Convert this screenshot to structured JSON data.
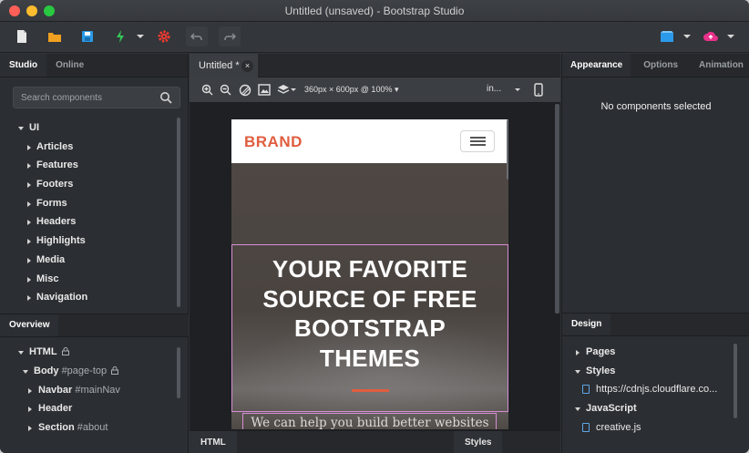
{
  "window": {
    "title": "Untitled (unsaved) - Bootstrap Studio"
  },
  "toolbar": {
    "icons": [
      "new-file-icon",
      "open-folder-icon",
      "save-icon",
      "preview-lightning-icon",
      "settings-icon",
      "undo-icon",
      "redo-icon",
      "export-icon",
      "publish-cloud-icon"
    ]
  },
  "left": {
    "tabs": [
      {
        "label": "Studio"
      },
      {
        "label": "Online"
      }
    ],
    "search_placeholder": "Search components",
    "root": "UI",
    "items": [
      {
        "label": "Articles"
      },
      {
        "label": "Features"
      },
      {
        "label": "Footers"
      },
      {
        "label": "Forms"
      },
      {
        "label": "Headers"
      },
      {
        "label": "Highlights"
      },
      {
        "label": "Media"
      },
      {
        "label": "Misc"
      },
      {
        "label": "Navigation"
      }
    ],
    "overview_tab": "Overview",
    "overview": {
      "html": "HTML",
      "body": "Body",
      "body_hint": "#page-top",
      "navbar": "Navbar",
      "navbar_hint": "#mainNav",
      "header": "Header",
      "section": "Section",
      "section_hint": "#about"
    }
  },
  "center": {
    "doc_tab": "Untitled *",
    "close_glyph": "×",
    "viewport": "360px × 600px @ 100% ▾",
    "insert_label": "in...",
    "page": {
      "brand": "BRAND",
      "heading_lines": [
        "YOUR FAVORITE",
        "SOURCE OF FREE",
        "BOOTSTRAP",
        "THEMES"
      ],
      "subtext": "We can help you build better websites"
    },
    "bottom_tabs": {
      "html": "HTML",
      "styles": "Styles"
    }
  },
  "right": {
    "tabs": [
      {
        "label": "Appearance"
      },
      {
        "label": "Options"
      },
      {
        "label": "Animation"
      }
    ],
    "no_selection": "No components selected",
    "design_tab": "Design",
    "design": {
      "pages": "Pages",
      "styles": "Styles",
      "style_file": "https://cdnjs.cloudflare.co...",
      "javascript": "JavaScript",
      "js_file": "creative.js"
    }
  },
  "colors": {
    "accent": "#e05d3f",
    "selection": "#d58ed3",
    "save_blue": "#2b9ae8",
    "lightning_green": "#34c759",
    "settings_red": "#ff3b30",
    "publish_pink": "#e8318a"
  }
}
